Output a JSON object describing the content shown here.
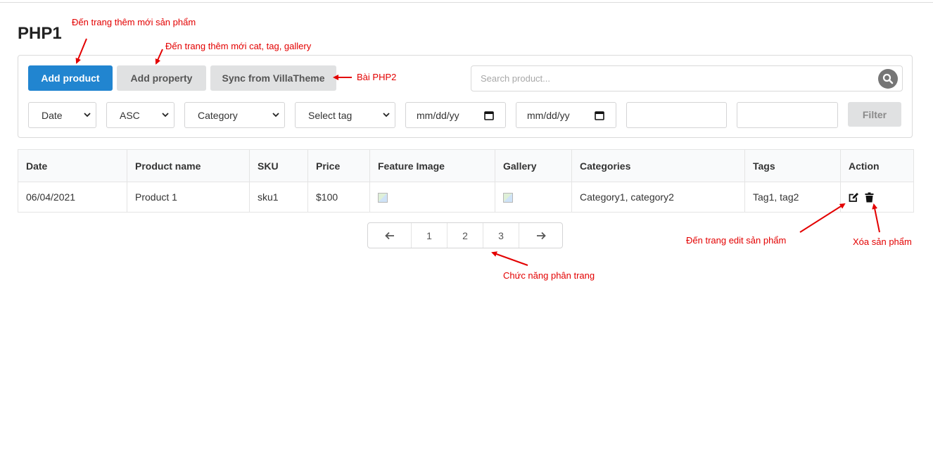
{
  "page": {
    "title": "PHP1"
  },
  "toolbar": {
    "add_product": "Add product",
    "add_property": "Add property",
    "sync": "Sync from VillaTheme",
    "search_placeholder": "Search product...",
    "filter": "Filter"
  },
  "filters": {
    "sort_by": "Date",
    "order": "ASC",
    "category": "Category",
    "tag": "Select tag",
    "date_from": "mm/dd/yy",
    "date_to": "mm/dd/yy",
    "price_min": "",
    "price_max": ""
  },
  "table": {
    "headers": [
      "Date",
      "Product name",
      "SKU",
      "Price",
      "Feature Image",
      "Gallery",
      "Categories",
      "Tags",
      "Action"
    ],
    "rows": [
      {
        "date": "06/04/2021",
        "name": "Product 1",
        "sku": "sku1",
        "price": "$100",
        "categories": "Category1, category2",
        "tags": "Tag1, tag2"
      }
    ]
  },
  "pagination": {
    "pages": [
      "1",
      "2",
      "3"
    ]
  },
  "annotations": {
    "add_product": "Đến trang thêm mới sản phẩm",
    "add_property": "Đến trang thêm mới cat, tag, gallery",
    "sync": "Bài PHP2",
    "edit": "Đến trang edit sản phẩm",
    "delete": "Xóa sản phẩm",
    "pagination": "Chức năng phân trang"
  },
  "colors": {
    "primary": "#2185d0",
    "annotation": "#e30000",
    "button_grey": "#e0e1e2"
  },
  "icons": {
    "search": "search-icon",
    "prev": "arrow-left-icon",
    "next": "arrow-right-icon",
    "edit": "edit-icon",
    "delete": "trash-icon"
  }
}
